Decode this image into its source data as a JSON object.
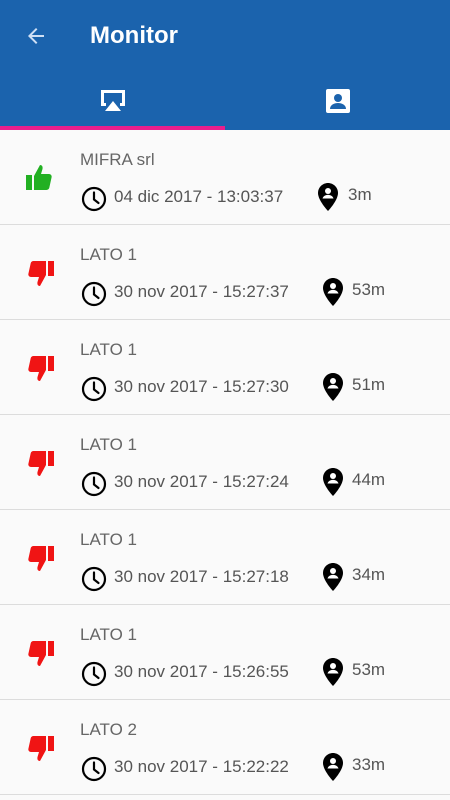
{
  "header": {
    "title": "Monitor",
    "back_icon": "arrow-back-icon",
    "background_color": "#1b63ad",
    "tab_indicator_color": "#e91e8c"
  },
  "tabs": [
    {
      "icon": "cast-screen-icon",
      "active": true
    },
    {
      "icon": "contact-card-icon",
      "active": false
    }
  ],
  "items": [
    {
      "name": "MIFRA srl",
      "time": "04 dic 2017 - 13:03:37",
      "distance": "3m",
      "status": "up"
    },
    {
      "name": "LATO 1",
      "time": "30 nov 2017 - 15:27:37",
      "distance": "53m",
      "status": "down"
    },
    {
      "name": "LATO 1",
      "time": "30 nov 2017 - 15:27:30",
      "distance": "51m",
      "status": "down"
    },
    {
      "name": "LATO 1",
      "time": "30 nov 2017 - 15:27:24",
      "distance": "44m",
      "status": "down"
    },
    {
      "name": "LATO 1",
      "time": "30 nov 2017 - 15:27:18",
      "distance": "34m",
      "status": "down"
    },
    {
      "name": "LATO 1",
      "time": "30 nov 2017 - 15:26:55",
      "distance": "53m",
      "status": "down"
    },
    {
      "name": "LATO 2",
      "time": "30 nov 2017 - 15:22:22",
      "distance": "33m",
      "status": "down"
    }
  ],
  "colors": {
    "thumb_up": "#22b022",
    "thumb_down": "#f01414"
  }
}
